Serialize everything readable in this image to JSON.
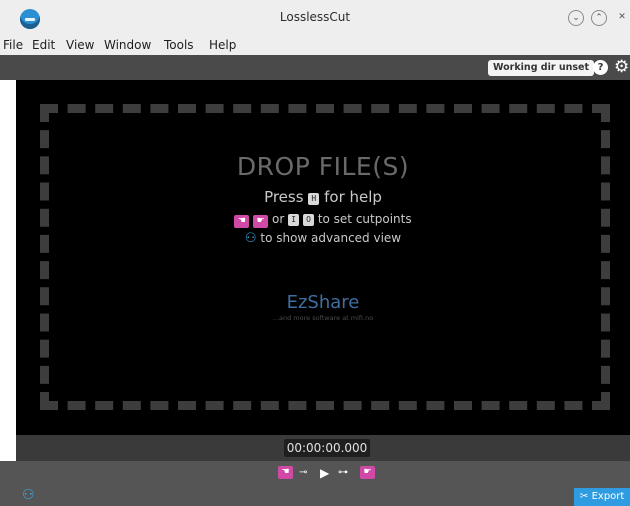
{
  "window": {
    "title": "LosslessCut",
    "icon": "losslesscut-app-icon",
    "controls": [
      "minimize",
      "maximize",
      "close"
    ]
  },
  "menu": [
    "File",
    "Edit",
    "View",
    "Window",
    "Tools",
    "Help"
  ],
  "topbar": {
    "working_dir": "Working dir unset",
    "help_label": "?",
    "settings_icon": "gear-icon"
  },
  "dropzone": {
    "title": "DROP FILE(S)",
    "help_prefix": "Press",
    "help_key": "H",
    "help_suffix": "for help",
    "or_text": "or",
    "key_i": "I",
    "key_o": "O",
    "cutpoints_text": "to set cutpoints",
    "advanced_text": "to show advanced view",
    "ezshare": "EzShare",
    "more_software": "...and more software at mifi.no"
  },
  "timeline": {
    "timecode": "00:00:00.000"
  },
  "bottom": {
    "export_label": "Export"
  },
  "colors": {
    "accent_pink": "#d149a7",
    "accent_blue": "#2f9be0",
    "ezshare_blue": "#3f6fa0"
  }
}
